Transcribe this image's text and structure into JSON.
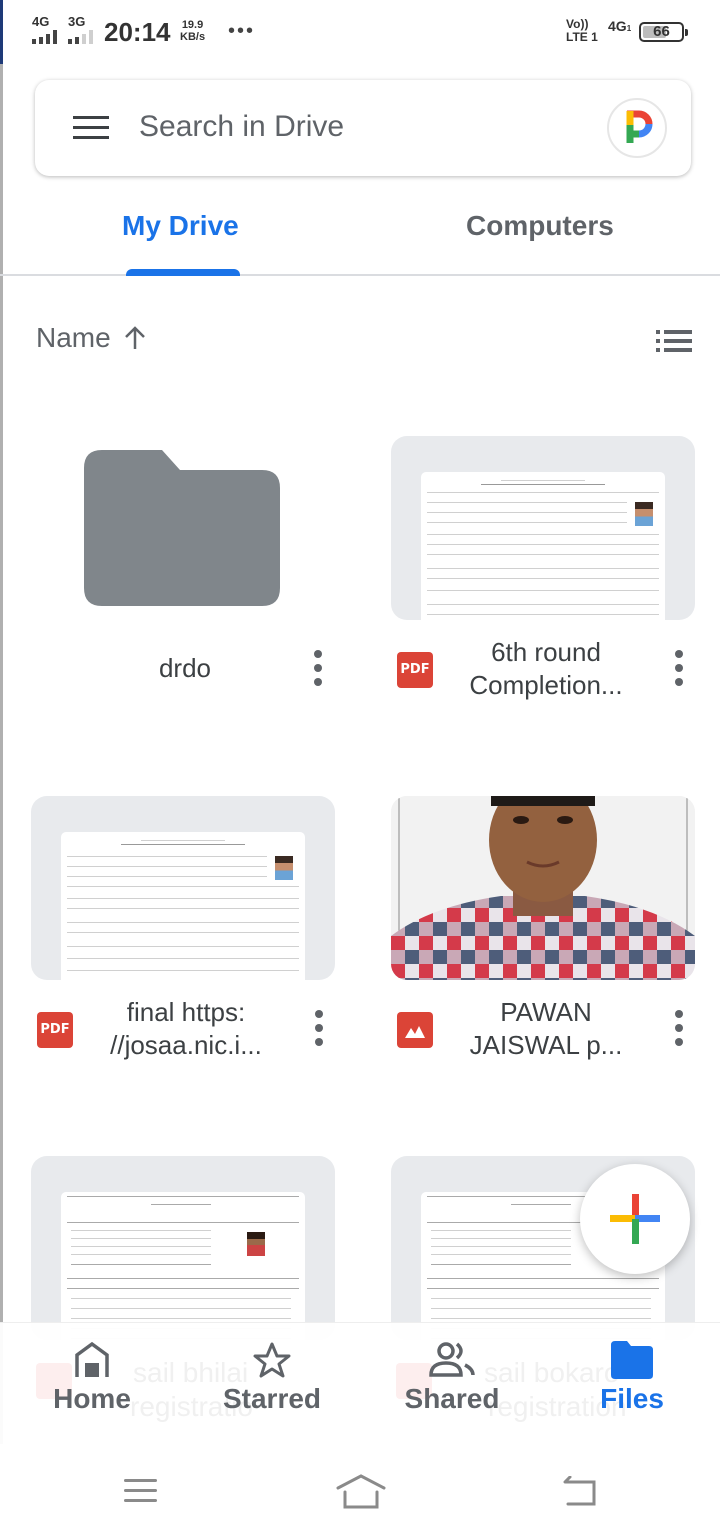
{
  "status_bar": {
    "sim1_network": "4G",
    "sim2_network": "3G",
    "time": "20:14",
    "speed_value": "19.9",
    "speed_unit": "KB/s",
    "more": "•••",
    "volte_top": "Vo))",
    "volte_bottom": "LTE 1",
    "data_network": "4G",
    "data_sub": "1",
    "battery_percent": "66",
    "battery_level": 0.66
  },
  "search": {
    "placeholder": "Search in Drive",
    "menu_icon": "hamburger-menu-icon",
    "avatar_letter": "P"
  },
  "tabs": [
    {
      "label": "My Drive",
      "active": true
    },
    {
      "label": "Computers",
      "active": false
    }
  ],
  "sort": {
    "label": "Name",
    "direction_icon": "arrow-up-icon",
    "view_toggle_icon": "list-view-icon"
  },
  "files": [
    {
      "name": "drdo",
      "type": "folder"
    },
    {
      "name": "6th round Completion...",
      "line1": "6th round",
      "line2": "Completion...",
      "type": "pdf",
      "badge": "PDF"
    },
    {
      "name": "final https://josaa.nic.i...",
      "line1": "final https:",
      "line2": "//josaa.nic.i...",
      "type": "pdf",
      "badge": "PDF"
    },
    {
      "name": "PAWAN JAISWAL p...",
      "line1": "PAWAN",
      "line2": "JAISWAL p...",
      "type": "image"
    },
    {
      "name": "sail bhilai registratio...",
      "line1": "sail bhilai",
      "line2": "registratio",
      "type": "pdf",
      "badge": "PDF"
    },
    {
      "name": "sail bokaro registration...",
      "line1": "sail bokaro",
      "line2": "registration",
      "type": "pdf",
      "badge": "PDF"
    }
  ],
  "fab": {
    "icon": "plus-icon",
    "label": "New"
  },
  "bottom_nav": [
    {
      "label": "Home",
      "icon": "home-icon",
      "active": false
    },
    {
      "label": "Starred",
      "icon": "star-icon",
      "active": false
    },
    {
      "label": "Shared",
      "icon": "shared-people-icon",
      "active": false
    },
    {
      "label": "Files",
      "icon": "folder-icon",
      "active": true
    }
  ],
  "colors": {
    "accent": "#1a73e8",
    "pdf_red": "#db4437",
    "folder_gray": "#80868b",
    "text_gray": "#5f6368"
  }
}
